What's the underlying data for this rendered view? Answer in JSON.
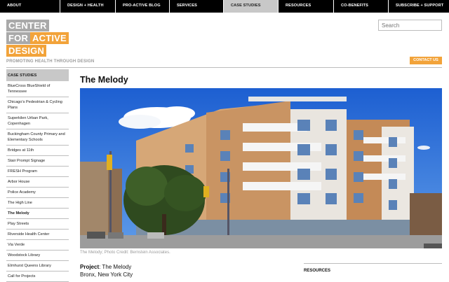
{
  "nav": {
    "items": [
      {
        "label": "ABOUT"
      },
      {
        "label": "DESIGN + HEALTH"
      },
      {
        "label": "PRO-ACTIVE BLOG"
      },
      {
        "label": "SERVICES"
      },
      {
        "label": "CASE STUDIES",
        "active": true
      },
      {
        "label": "RESOURCES"
      },
      {
        "label": "CO-BENEFITS"
      },
      {
        "label": "SUBSCRIBE + SUPPORT"
      }
    ]
  },
  "logo": {
    "line1": "CENTER",
    "line2a": "FOR",
    "line2b": "ACTIVE",
    "line3": "DESIGN",
    "tagline": "PROMOTING HEALTH THROUGH DESIGN"
  },
  "search": {
    "placeholder": "Search"
  },
  "contact_label": "CONTACT US",
  "sidebar": {
    "heading": "CASE STUDIES",
    "items": [
      {
        "label": "BlueCross BlueShield of Tennessee"
      },
      {
        "label": "Chicago's Pedestrian & Cycling Plans"
      },
      {
        "label": "Superkilen Urban Park, Copenhagen"
      },
      {
        "label": "Buckingham County Primary and Elementary Schools"
      },
      {
        "label": "Bridges at 11th"
      },
      {
        "label": "Stair Prompt Signage"
      },
      {
        "label": "FRESH Program"
      },
      {
        "label": "Arbor House"
      },
      {
        "label": "Police Academy"
      },
      {
        "label": "The High Line"
      },
      {
        "label": "The Melody",
        "active": true
      },
      {
        "label": "Play Streets"
      },
      {
        "label": "Riverside Health Center"
      },
      {
        "label": "Via Verde"
      },
      {
        "label": "Woodstock Library"
      },
      {
        "label": "Elmhurst Queens Library"
      },
      {
        "label": "Call for Projects"
      }
    ]
  },
  "main": {
    "title": "The Melody",
    "caption": "The Melody; Photo Credit: Bernstein Associates.",
    "project_label": "Project",
    "project_value": ": The Melody",
    "location": "Bronx, New York City",
    "resources_heading": "RESOURCES"
  },
  "colors": {
    "accent": "#f2a33a",
    "logo_gray": "#a9a9a9",
    "nav_bg": "#000000",
    "nav_active": "#c8c8c8"
  }
}
